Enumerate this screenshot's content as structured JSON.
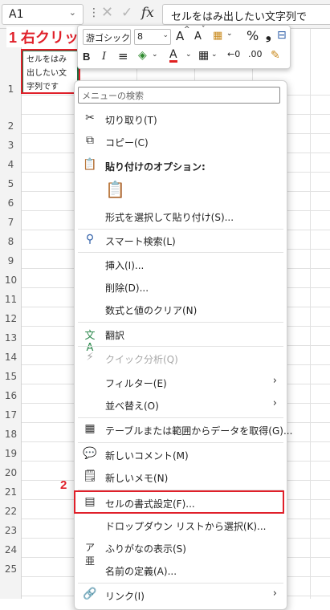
{
  "formula_bar": {
    "name_box": "A1",
    "cancel_icon": "✕",
    "enter_icon": "✓",
    "fx_label": "fx",
    "content": "セルをはみ出したい文字列で"
  },
  "cell_a1": {
    "text": "セルをはみ出したい文字列です"
  },
  "row_numbers": [
    "1",
    "2",
    "3",
    "4",
    "5",
    "6",
    "7",
    "8",
    "9",
    "10",
    "11",
    "12",
    "13",
    "14",
    "15",
    "16",
    "17",
    "18",
    "19",
    "20",
    "21",
    "22",
    "23",
    "24",
    "25"
  ],
  "annotations": {
    "step1": "1 右クリック",
    "step2": "2"
  },
  "mini_toolbar": {
    "font_name": "游ゴシック",
    "font_size": "8",
    "grow_font": "A",
    "shrink_font": "A",
    "percent": "%",
    "comma": "❟",
    "bold": "B",
    "italic": "I",
    "font_color": "A"
  },
  "menu": {
    "search_placeholder": "メニューの検索",
    "items": [
      {
        "label": "切り取り(T)"
      },
      {
        "label": "コピー(C)"
      },
      {
        "label": "貼り付けのオプション:"
      },
      {
        "label": "形式を選択して貼り付け(S)..."
      },
      {
        "label": "スマート検索(L)"
      },
      {
        "label": "挿入(I)..."
      },
      {
        "label": "削除(D)..."
      },
      {
        "label": "数式と値のクリア(N)"
      },
      {
        "label": "翻訳"
      },
      {
        "label": "クイック分析(Q)"
      },
      {
        "label": "フィルター(E)"
      },
      {
        "label": "並べ替え(O)"
      },
      {
        "label": "テーブルまたは範囲からデータを取得(G)..."
      },
      {
        "label": "新しいコメント(M)"
      },
      {
        "label": "新しいメモ(N)"
      },
      {
        "label": "セルの書式設定(F)..."
      },
      {
        "label": "ドロップダウン リストから選択(K)..."
      },
      {
        "label": "ふりがなの表示(S)"
      },
      {
        "label": "名前の定義(A)..."
      },
      {
        "label": "リンク(I)"
      }
    ]
  }
}
